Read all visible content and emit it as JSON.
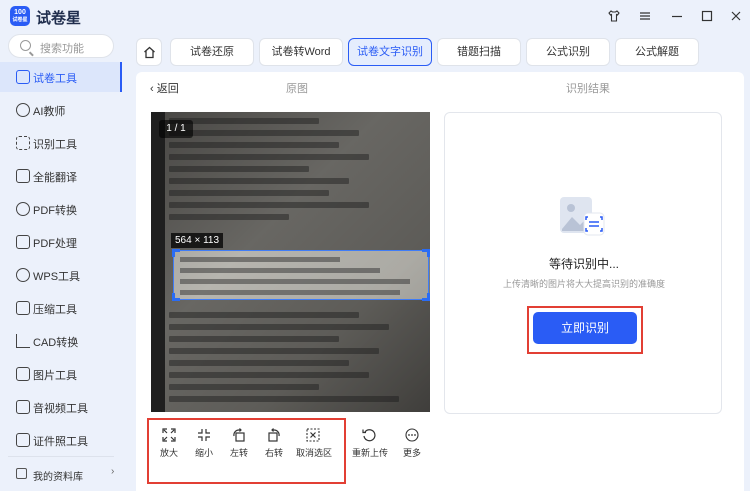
{
  "app": {
    "logo_top": "100",
    "logo_bottom": "试卷星",
    "name": "试卷星"
  },
  "window": {
    "skin_icon": "shirt-icon",
    "menu_icon": "hamburger-icon",
    "minimize_icon": "minimize-icon",
    "maximize_icon": "maximize-icon",
    "close_icon": "close-icon"
  },
  "sidebar": {
    "search_placeholder": "搜索功能",
    "items": [
      {
        "label": "试卷工具",
        "icon": "layers-icon",
        "active": true
      },
      {
        "label": "AI教师",
        "icon": "ai-teacher-icon",
        "active": false
      },
      {
        "label": "识别工具",
        "icon": "scan-icon",
        "active": false
      },
      {
        "label": "全能翻译",
        "icon": "translate-icon",
        "active": false
      },
      {
        "label": "PDF转换",
        "icon": "pdf-convert-icon",
        "active": false
      },
      {
        "label": "PDF处理",
        "icon": "pdf-process-icon",
        "active": false
      },
      {
        "label": "WPS工具",
        "icon": "wps-icon",
        "active": false
      },
      {
        "label": "压缩工具",
        "icon": "compress-icon",
        "active": false
      },
      {
        "label": "CAD转换",
        "icon": "cad-icon",
        "active": false
      },
      {
        "label": "图片工具",
        "icon": "image-icon",
        "active": false
      },
      {
        "label": "音视频工具",
        "icon": "video-icon",
        "active": false
      },
      {
        "label": "证件照工具",
        "icon": "id-photo-icon",
        "active": false
      }
    ],
    "library_label": "我的资料库",
    "library_arrow": "›"
  },
  "tabs": [
    {
      "label": "试卷还原",
      "active": false
    },
    {
      "label": "试卷转Word",
      "active": false
    },
    {
      "label": "试卷文字识别",
      "active": true
    },
    {
      "label": "错题扫描",
      "active": false
    },
    {
      "label": "公式识别",
      "active": false
    },
    {
      "label": "公式解题",
      "active": false
    }
  ],
  "panel": {
    "back_label": "返回",
    "original_header": "原图",
    "result_header": "识别结果",
    "page_indicator": "1 / 1",
    "selection_size": "564 × 113"
  },
  "toolbar": [
    {
      "label": "放大",
      "icon": "zoom-in-icon"
    },
    {
      "label": "缩小",
      "icon": "zoom-out-icon"
    },
    {
      "label": "左转",
      "icon": "rotate-left-icon"
    },
    {
      "label": "右转",
      "icon": "rotate-right-icon"
    },
    {
      "label": "取消选区",
      "icon": "cancel-selection-icon"
    },
    {
      "label": "重新上传",
      "icon": "re-upload-icon"
    },
    {
      "label": "更多",
      "icon": "more-icon"
    }
  ],
  "result": {
    "status": "等待识别中...",
    "hint": "上传清晰的图片将大大提高识别的准确度",
    "recognize_button": "立即识别"
  },
  "colors": {
    "accent": "#2a5cf5",
    "highlight_frame": "#e23f34",
    "background": "#ecf1fb"
  }
}
